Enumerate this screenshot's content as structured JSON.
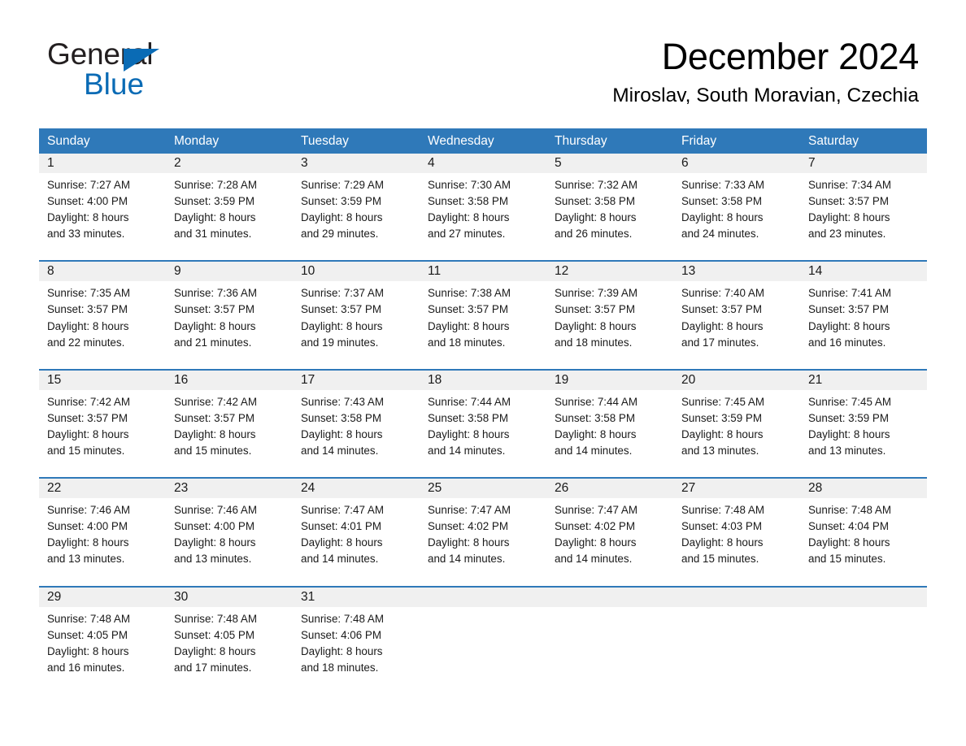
{
  "brand": {
    "name_part1": "General",
    "name_part2": "Blue",
    "accent_color": "#0a6bb5",
    "triangle_icon": "brand-triangle-icon"
  },
  "header": {
    "title": "December 2024",
    "subtitle": "Miroslav, South Moravian, Czechia"
  },
  "theme": {
    "header_blue": "#2f79b9",
    "date_band_gray": "#f0f0f0",
    "text": "#1a1a1a"
  },
  "weekdays": [
    "Sunday",
    "Monday",
    "Tuesday",
    "Wednesday",
    "Thursday",
    "Friday",
    "Saturday"
  ],
  "weeks": [
    {
      "days": [
        {
          "date": "1",
          "sunrise": "Sunrise: 7:27 AM",
          "sunset": "Sunset: 4:00 PM",
          "daylight_line1": "Daylight: 8 hours",
          "daylight_line2": "and 33 minutes."
        },
        {
          "date": "2",
          "sunrise": "Sunrise: 7:28 AM",
          "sunset": "Sunset: 3:59 PM",
          "daylight_line1": "Daylight: 8 hours",
          "daylight_line2": "and 31 minutes."
        },
        {
          "date": "3",
          "sunrise": "Sunrise: 7:29 AM",
          "sunset": "Sunset: 3:59 PM",
          "daylight_line1": "Daylight: 8 hours",
          "daylight_line2": "and 29 minutes."
        },
        {
          "date": "4",
          "sunrise": "Sunrise: 7:30 AM",
          "sunset": "Sunset: 3:58 PM",
          "daylight_line1": "Daylight: 8 hours",
          "daylight_line2": "and 27 minutes."
        },
        {
          "date": "5",
          "sunrise": "Sunrise: 7:32 AM",
          "sunset": "Sunset: 3:58 PM",
          "daylight_line1": "Daylight: 8 hours",
          "daylight_line2": "and 26 minutes."
        },
        {
          "date": "6",
          "sunrise": "Sunrise: 7:33 AM",
          "sunset": "Sunset: 3:58 PM",
          "daylight_line1": "Daylight: 8 hours",
          "daylight_line2": "and 24 minutes."
        },
        {
          "date": "7",
          "sunrise": "Sunrise: 7:34 AM",
          "sunset": "Sunset: 3:57 PM",
          "daylight_line1": "Daylight: 8 hours",
          "daylight_line2": "and 23 minutes."
        }
      ]
    },
    {
      "days": [
        {
          "date": "8",
          "sunrise": "Sunrise: 7:35 AM",
          "sunset": "Sunset: 3:57 PM",
          "daylight_line1": "Daylight: 8 hours",
          "daylight_line2": "and 22 minutes."
        },
        {
          "date": "9",
          "sunrise": "Sunrise: 7:36 AM",
          "sunset": "Sunset: 3:57 PM",
          "daylight_line1": "Daylight: 8 hours",
          "daylight_line2": "and 21 minutes."
        },
        {
          "date": "10",
          "sunrise": "Sunrise: 7:37 AM",
          "sunset": "Sunset: 3:57 PM",
          "daylight_line1": "Daylight: 8 hours",
          "daylight_line2": "and 19 minutes."
        },
        {
          "date": "11",
          "sunrise": "Sunrise: 7:38 AM",
          "sunset": "Sunset: 3:57 PM",
          "daylight_line1": "Daylight: 8 hours",
          "daylight_line2": "and 18 minutes."
        },
        {
          "date": "12",
          "sunrise": "Sunrise: 7:39 AM",
          "sunset": "Sunset: 3:57 PM",
          "daylight_line1": "Daylight: 8 hours",
          "daylight_line2": "and 18 minutes."
        },
        {
          "date": "13",
          "sunrise": "Sunrise: 7:40 AM",
          "sunset": "Sunset: 3:57 PM",
          "daylight_line1": "Daylight: 8 hours",
          "daylight_line2": "and 17 minutes."
        },
        {
          "date": "14",
          "sunrise": "Sunrise: 7:41 AM",
          "sunset": "Sunset: 3:57 PM",
          "daylight_line1": "Daylight: 8 hours",
          "daylight_line2": "and 16 minutes."
        }
      ]
    },
    {
      "days": [
        {
          "date": "15",
          "sunrise": "Sunrise: 7:42 AM",
          "sunset": "Sunset: 3:57 PM",
          "daylight_line1": "Daylight: 8 hours",
          "daylight_line2": "and 15 minutes."
        },
        {
          "date": "16",
          "sunrise": "Sunrise: 7:42 AM",
          "sunset": "Sunset: 3:57 PM",
          "daylight_line1": "Daylight: 8 hours",
          "daylight_line2": "and 15 minutes."
        },
        {
          "date": "17",
          "sunrise": "Sunrise: 7:43 AM",
          "sunset": "Sunset: 3:58 PM",
          "daylight_line1": "Daylight: 8 hours",
          "daylight_line2": "and 14 minutes."
        },
        {
          "date": "18",
          "sunrise": "Sunrise: 7:44 AM",
          "sunset": "Sunset: 3:58 PM",
          "daylight_line1": "Daylight: 8 hours",
          "daylight_line2": "and 14 minutes."
        },
        {
          "date": "19",
          "sunrise": "Sunrise: 7:44 AM",
          "sunset": "Sunset: 3:58 PM",
          "daylight_line1": "Daylight: 8 hours",
          "daylight_line2": "and 14 minutes."
        },
        {
          "date": "20",
          "sunrise": "Sunrise: 7:45 AM",
          "sunset": "Sunset: 3:59 PM",
          "daylight_line1": "Daylight: 8 hours",
          "daylight_line2": "and 13 minutes."
        },
        {
          "date": "21",
          "sunrise": "Sunrise: 7:45 AM",
          "sunset": "Sunset: 3:59 PM",
          "daylight_line1": "Daylight: 8 hours",
          "daylight_line2": "and 13 minutes."
        }
      ]
    },
    {
      "days": [
        {
          "date": "22",
          "sunrise": "Sunrise: 7:46 AM",
          "sunset": "Sunset: 4:00 PM",
          "daylight_line1": "Daylight: 8 hours",
          "daylight_line2": "and 13 minutes."
        },
        {
          "date": "23",
          "sunrise": "Sunrise: 7:46 AM",
          "sunset": "Sunset: 4:00 PM",
          "daylight_line1": "Daylight: 8 hours",
          "daylight_line2": "and 13 minutes."
        },
        {
          "date": "24",
          "sunrise": "Sunrise: 7:47 AM",
          "sunset": "Sunset: 4:01 PM",
          "daylight_line1": "Daylight: 8 hours",
          "daylight_line2": "and 14 minutes."
        },
        {
          "date": "25",
          "sunrise": "Sunrise: 7:47 AM",
          "sunset": "Sunset: 4:02 PM",
          "daylight_line1": "Daylight: 8 hours",
          "daylight_line2": "and 14 minutes."
        },
        {
          "date": "26",
          "sunrise": "Sunrise: 7:47 AM",
          "sunset": "Sunset: 4:02 PM",
          "daylight_line1": "Daylight: 8 hours",
          "daylight_line2": "and 14 minutes."
        },
        {
          "date": "27",
          "sunrise": "Sunrise: 7:48 AM",
          "sunset": "Sunset: 4:03 PM",
          "daylight_line1": "Daylight: 8 hours",
          "daylight_line2": "and 15 minutes."
        },
        {
          "date": "28",
          "sunrise": "Sunrise: 7:48 AM",
          "sunset": "Sunset: 4:04 PM",
          "daylight_line1": "Daylight: 8 hours",
          "daylight_line2": "and 15 minutes."
        }
      ]
    },
    {
      "days": [
        {
          "date": "29",
          "sunrise": "Sunrise: 7:48 AM",
          "sunset": "Sunset: 4:05 PM",
          "daylight_line1": "Daylight: 8 hours",
          "daylight_line2": "and 16 minutes."
        },
        {
          "date": "30",
          "sunrise": "Sunrise: 7:48 AM",
          "sunset": "Sunset: 4:05 PM",
          "daylight_line1": "Daylight: 8 hours",
          "daylight_line2": "and 17 minutes."
        },
        {
          "date": "31",
          "sunrise": "Sunrise: 7:48 AM",
          "sunset": "Sunset: 4:06 PM",
          "daylight_line1": "Daylight: 8 hours",
          "daylight_line2": "and 18 minutes."
        },
        {
          "date": "",
          "sunrise": "",
          "sunset": "",
          "daylight_line1": "",
          "daylight_line2": ""
        },
        {
          "date": "",
          "sunrise": "",
          "sunset": "",
          "daylight_line1": "",
          "daylight_line2": ""
        },
        {
          "date": "",
          "sunrise": "",
          "sunset": "",
          "daylight_line1": "",
          "daylight_line2": ""
        },
        {
          "date": "",
          "sunrise": "",
          "sunset": "",
          "daylight_line1": "",
          "daylight_line2": ""
        }
      ]
    }
  ]
}
